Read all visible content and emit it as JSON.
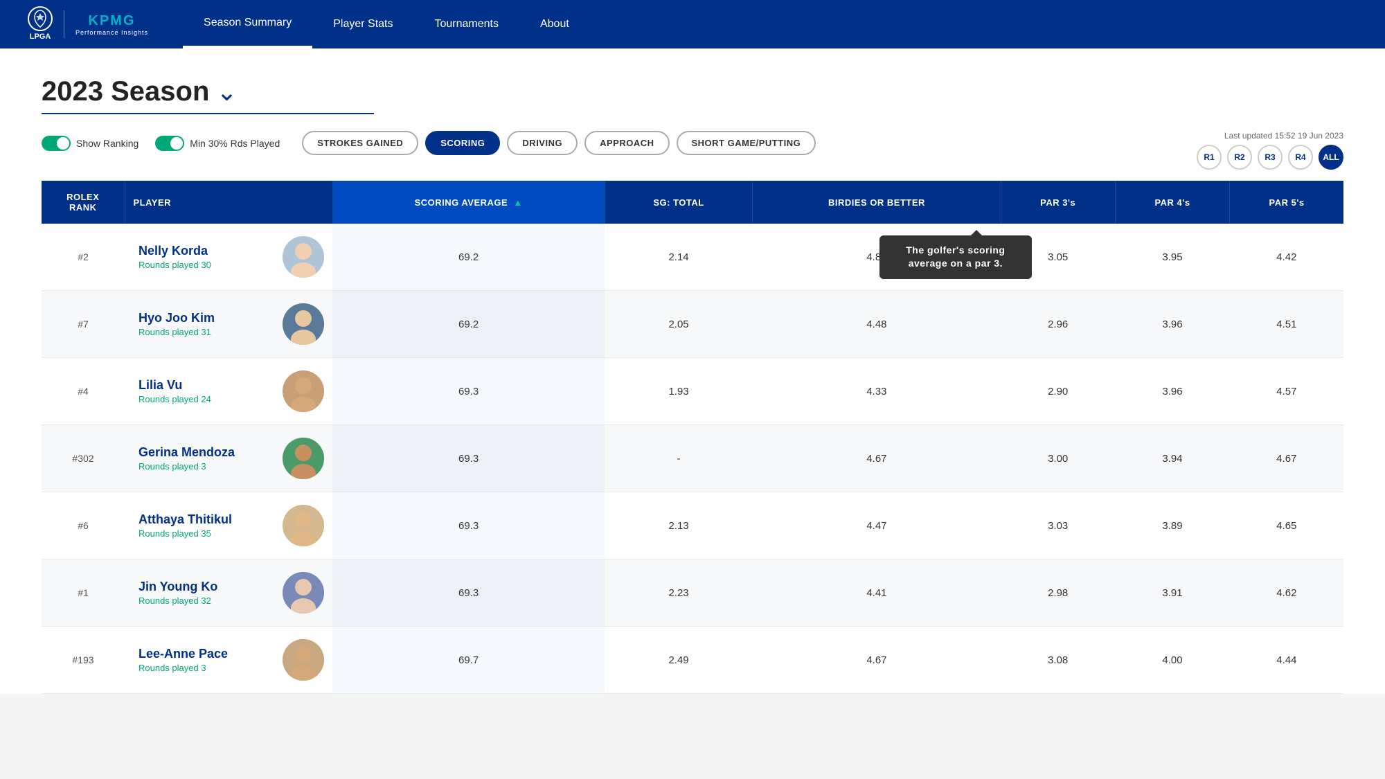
{
  "header": {
    "lpga_label": "LPGA",
    "kpmg_label": "KPMG",
    "kpmg_sub": "Performance Insights",
    "nav": [
      {
        "label": "Season Summary",
        "active": true
      },
      {
        "label": "Player Stats",
        "active": false
      },
      {
        "label": "Tournaments",
        "active": false
      },
      {
        "label": "About",
        "active": false
      }
    ]
  },
  "season": {
    "title": "2023 Season",
    "chevron": "✓"
  },
  "controls": {
    "toggle1_label": "Show Ranking",
    "toggle2_label": "Min 30% Rds Played",
    "filters": [
      {
        "label": "STROKES GAINED",
        "active": false
      },
      {
        "label": "SCORING",
        "active": true
      },
      {
        "label": "DRIVING",
        "active": false
      },
      {
        "label": "APPROACH",
        "active": false
      },
      {
        "label": "SHORT GAME/PUTTING",
        "active": false
      }
    ],
    "last_updated": "Last updated 15:52 19 Jun 2023",
    "rounds": [
      {
        "label": "R1",
        "active": false
      },
      {
        "label": "R2",
        "active": false
      },
      {
        "label": "R3",
        "active": false
      },
      {
        "label": "R4",
        "active": false
      },
      {
        "label": "ALL",
        "active": true
      }
    ]
  },
  "tooltip": {
    "text": "The golfer's scoring average on a par 3."
  },
  "table": {
    "columns": [
      {
        "key": "rank",
        "label": "ROLEX\nRANK"
      },
      {
        "key": "player",
        "label": "PLAYER"
      },
      {
        "key": "scoring_avg",
        "label": "SCORING AVERAGE"
      },
      {
        "key": "sg_total",
        "label": "SG: TOTAL"
      },
      {
        "key": "birdies",
        "label": "BIRDIES OR BETTER"
      },
      {
        "key": "par3",
        "label": "PAR 3's"
      },
      {
        "key": "par4",
        "label": "PAR 4's"
      },
      {
        "key": "par5",
        "label": "PAR 5's"
      }
    ],
    "rows": [
      {
        "rank": "#2",
        "name": "Nelly Korda",
        "rounds": "Rounds played 30",
        "avatar_class": "avatar-1",
        "scoring_avg": "69.2",
        "sg_total": "2.14",
        "birdies": "4.80",
        "par3": "3.05",
        "par4": "3.95",
        "par5": "4.42"
      },
      {
        "rank": "#7",
        "name": "Hyo Joo Kim",
        "rounds": "Rounds played 31",
        "avatar_class": "avatar-2",
        "scoring_avg": "69.2",
        "sg_total": "2.05",
        "birdies": "4.48",
        "par3": "2.96",
        "par4": "3.96",
        "par5": "4.51"
      },
      {
        "rank": "#4",
        "name": "Lilia Vu",
        "rounds": "Rounds played 24",
        "avatar_class": "avatar-3",
        "scoring_avg": "69.3",
        "sg_total": "1.93",
        "birdies": "4.33",
        "par3": "2.90",
        "par4": "3.96",
        "par5": "4.57"
      },
      {
        "rank": "#302",
        "name": "Gerina Mendoza",
        "rounds": "Rounds played 3",
        "avatar_class": "avatar-4",
        "scoring_avg": "69.3",
        "sg_total": "-",
        "birdies": "4.67",
        "par3": "3.00",
        "par4": "3.94",
        "par5": "4.67"
      },
      {
        "rank": "#6",
        "name": "Atthaya Thitikul",
        "rounds": "Rounds played 35",
        "avatar_class": "avatar-5",
        "scoring_avg": "69.3",
        "sg_total": "2.13",
        "birdies": "4.47",
        "par3": "3.03",
        "par4": "3.89",
        "par5": "4.65"
      },
      {
        "rank": "#1",
        "name": "Jin Young Ko",
        "rounds": "Rounds played 32",
        "avatar_class": "avatar-6",
        "scoring_avg": "69.3",
        "sg_total": "2.23",
        "birdies": "4.41",
        "par3": "2.98",
        "par4": "3.91",
        "par5": "4.62"
      },
      {
        "rank": "#193",
        "name": "Lee-Anne Pace",
        "rounds": "Rounds played 3",
        "avatar_class": "avatar-7",
        "scoring_avg": "69.7",
        "sg_total": "2.49",
        "birdies": "4.67",
        "par3": "3.08",
        "par4": "4.00",
        "par5": "4.44"
      }
    ]
  }
}
